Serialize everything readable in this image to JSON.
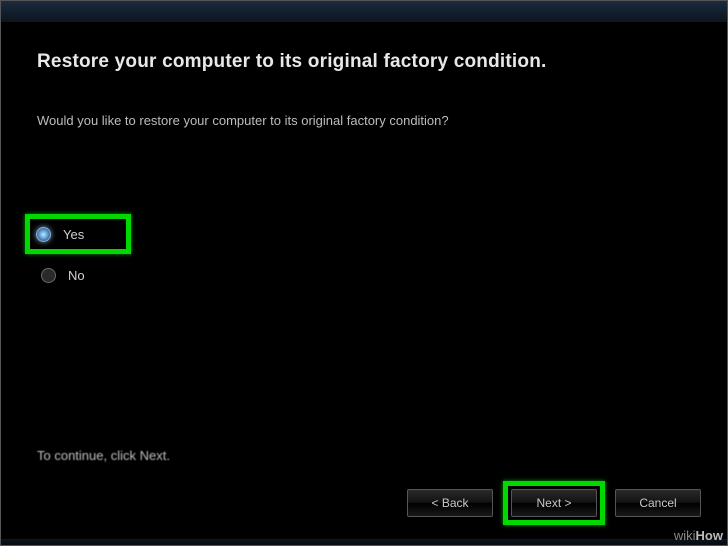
{
  "page_title": "Restore your computer to its original factory condition.",
  "question": "Would you like to restore your computer to its original factory condition?",
  "options": {
    "yes": {
      "label": "Yes",
      "selected": true
    },
    "no": {
      "label": "No",
      "selected": false
    }
  },
  "continue_hint": "To continue, click Next.",
  "buttons": {
    "back": "< Back",
    "next": "Next >",
    "cancel": "Cancel"
  },
  "watermark": {
    "wiki": "wiki",
    "how": "How"
  },
  "highlights": [
    "radio-yes",
    "next-button"
  ]
}
